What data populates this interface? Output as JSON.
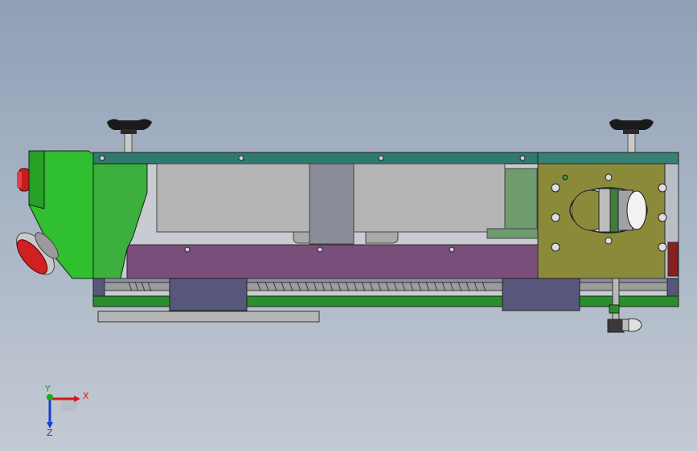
{
  "viewport": {
    "background_top": "#8fa0b6",
    "background_bottom": "#c3cad3"
  },
  "model": {
    "frame_color": "#2f7a6e",
    "drawer_color": "#7a4e7a",
    "mount_plate_color": "#8b8a3a",
    "rail_color": "#2a8f2a",
    "end_cap_color": "#3cb03c",
    "block_color": "#56577a",
    "panel_color": "#b6b6b6",
    "red_button_color": "#cc1f1f"
  },
  "triad": {
    "x_label": "X",
    "y_label": "Y",
    "z_label": "Z",
    "x_color": "#d41818",
    "y_color": "#18a818",
    "z_color": "#1a3ad4"
  }
}
